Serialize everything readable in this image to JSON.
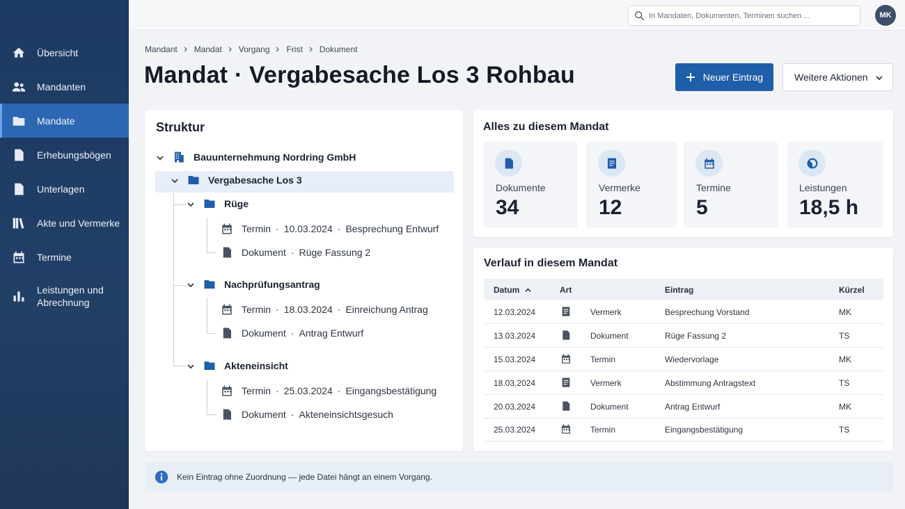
{
  "sidebar": {
    "items": [
      {
        "label": "Übersicht",
        "icon": "home-icon"
      },
      {
        "label": "Mandanten",
        "icon": "users-icon"
      },
      {
        "label": "Mandate",
        "icon": "folder-icon",
        "active": true
      },
      {
        "label": "Erhebungsbögen",
        "icon": "document-icon"
      },
      {
        "label": "Unterlagen",
        "icon": "document-icon"
      },
      {
        "label": "Akte und Vermerke",
        "icon": "books-icon"
      },
      {
        "label": "Termine",
        "icon": "calendar-icon"
      },
      {
        "label": "Leistungen und Abrechnung",
        "icon": "bar-chart-icon"
      }
    ]
  },
  "topbar": {
    "search_placeholder": "In Mandaten, Dokumenten, Terminen suchen ...",
    "avatar_initials": "MK"
  },
  "breadcrumb": [
    "Mandant",
    "Mandat",
    "Vorgang",
    "Frist",
    "Dokument"
  ],
  "page": {
    "title": "Mandat · Vergabesache Los 3 Rohbau",
    "primary_button": "Neuer Eintrag",
    "secondary_button": "Weitere Aktionen"
  },
  "tree": {
    "title": "Struktur",
    "client": "Bauunternehmung Nordring GmbH",
    "matter": "Vergabesache Los 3",
    "groups": [
      {
        "label": "Rüge",
        "entries": [
          {
            "type": "Termin",
            "date": "10.03.2024",
            "text": "Besprechung Entwurf"
          },
          {
            "type": "Dokument",
            "text": "Rüge Fassung 2"
          }
        ]
      },
      {
        "label": "Nachprüfungsantrag",
        "entries": [
          {
            "type": "Termin",
            "date": "18.03.2024",
            "text": "Einreichung Antrag"
          },
          {
            "type": "Dokument",
            "text": "Antrag Entwurf"
          }
        ]
      },
      {
        "label": "Akteneinsicht",
        "entries": [
          {
            "type": "Termin",
            "date": "25.03.2024",
            "text": "Eingangsbestätigung"
          },
          {
            "type": "Dokument",
            "text": "Akteneinsichtsgesuch"
          }
        ]
      }
    ]
  },
  "summary": {
    "title": "Alles zu diesem Mandat",
    "stats": [
      {
        "label": "Dokumente",
        "value": "34",
        "icon": "document-icon"
      },
      {
        "label": "Vermerke",
        "value": "12",
        "icon": "note-icon"
      },
      {
        "label": "Termine",
        "value": "5",
        "icon": "calendar-icon"
      },
      {
        "label": "Leistungen",
        "value": "18,5 h",
        "icon": "clock-icon"
      }
    ]
  },
  "history": {
    "title": "Verlauf in diesem Mandat",
    "columns": [
      "Datum",
      "Art",
      "Eintrag",
      "Kürzel"
    ],
    "rows": [
      {
        "date": "12.03.2024",
        "type": "Vermerk",
        "icon": "note-icon",
        "entry": "Besprechung Vorstand",
        "abbr": "MK"
      },
      {
        "date": "13.03.2024",
        "type": "Dokument",
        "icon": "document-icon",
        "entry": "Rüge Fassung 2",
        "abbr": "TS"
      },
      {
        "date": "15.03.2024",
        "type": "Termin",
        "icon": "calendar-icon",
        "entry": "Wiedervorlage",
        "abbr": "MK"
      },
      {
        "date": "18.03.2024",
        "type": "Vermerk",
        "icon": "note-icon",
        "entry": "Abstimmung Antragstext",
        "abbr": "TS"
      },
      {
        "date": "20.03.2024",
        "type": "Dokument",
        "icon": "document-icon",
        "entry": "Antrag Entwurf",
        "abbr": "MK"
      },
      {
        "date": "25.03.2024",
        "type": "Termin",
        "icon": "calendar-icon",
        "entry": "Eingangsbestätigung",
        "abbr": "TS"
      }
    ]
  },
  "info": {
    "text": "Kein Eintrag ohne Zuordnung — jede Datei hängt an einem Vorgang."
  },
  "colors": {
    "accent": "#1f5ea8",
    "sidebar": "#1d3a63",
    "active_nav": "#2d67b3"
  }
}
